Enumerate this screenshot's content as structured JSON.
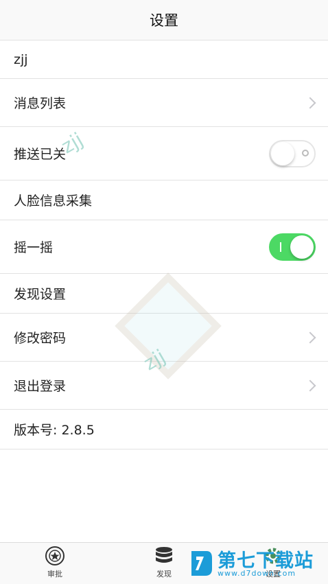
{
  "header": {
    "title": "设置"
  },
  "rows": [
    {
      "label": "zjj"
    },
    {
      "label": "消息列表"
    },
    {
      "label": "推送已关"
    },
    {
      "label": "人脸信息采集"
    },
    {
      "label": "摇一摇"
    },
    {
      "label": "发现设置"
    },
    {
      "label": "修改密码"
    },
    {
      "label": "退出登录"
    },
    {
      "label": "版本号: 2.8.5"
    }
  ],
  "toggles": {
    "push": false,
    "shake": true
  },
  "watermark": {
    "text1": "zjj",
    "text2": "zjj"
  },
  "tabbar": {
    "tabs": [
      {
        "label": "审批",
        "icon": "approval-badge-icon"
      },
      {
        "label": "发现",
        "icon": "database-stack-icon"
      },
      {
        "label": "设置",
        "icon": "gear-icon"
      }
    ]
  },
  "brand": {
    "name": "第七下载站",
    "url": "www.d7down.com"
  },
  "colors": {
    "toggle_on": "#4cd964",
    "brand": "#1c9cd8",
    "separator": "#e2e2e2"
  }
}
